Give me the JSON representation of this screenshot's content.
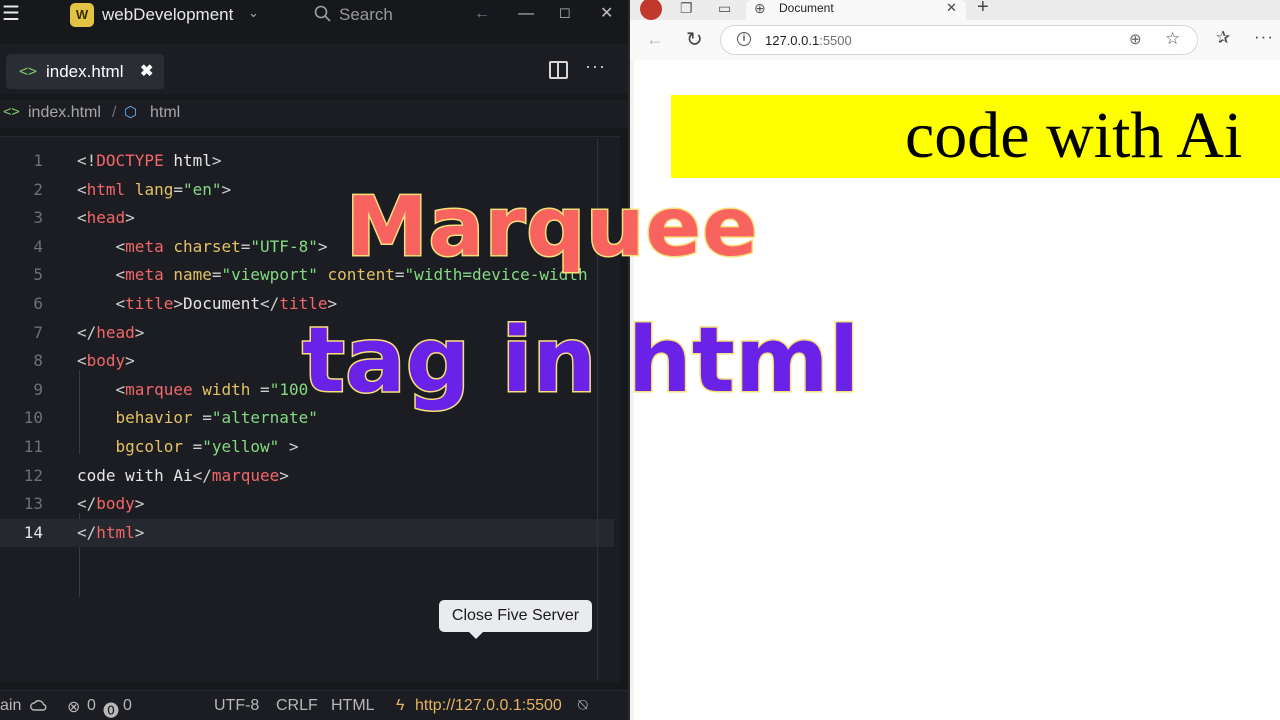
{
  "editor": {
    "workspace_badge": "W",
    "workspace_name": "webDevelopment",
    "search_placeholder": "Search",
    "tab": {
      "label": "index.html",
      "close": "✖"
    },
    "breadcrumb": {
      "file": "index.html",
      "separator": "/",
      "node": "html"
    },
    "code_lines": [
      {
        "n": "1",
        "tokens": [
          [
            "punc",
            "<!"
          ],
          [
            "tag",
            "DOCTYPE"
          ],
          [
            "text",
            " html"
          ],
          [
            "punc",
            ">"
          ]
        ]
      },
      {
        "n": "2",
        "tokens": [
          [
            "punc",
            "<"
          ],
          [
            "tag",
            "html"
          ],
          [
            "attr",
            " lang"
          ],
          [
            "punc",
            "="
          ],
          [
            "str",
            "\"en\""
          ],
          [
            "punc",
            ">"
          ]
        ]
      },
      {
        "n": "3",
        "tokens": [
          [
            "punc",
            "<"
          ],
          [
            "tag",
            "head"
          ],
          [
            "punc",
            ">"
          ]
        ]
      },
      {
        "n": "4",
        "tokens": [
          [
            "text",
            "    "
          ],
          [
            "punc",
            "<"
          ],
          [
            "tag",
            "meta"
          ],
          [
            "attr",
            " charset"
          ],
          [
            "punc",
            "="
          ],
          [
            "str",
            "\"UTF-8\""
          ],
          [
            "punc",
            ">"
          ]
        ]
      },
      {
        "n": "5",
        "tokens": [
          [
            "text",
            "    "
          ],
          [
            "punc",
            "<"
          ],
          [
            "tag",
            "meta"
          ],
          [
            "attr",
            " name"
          ],
          [
            "punc",
            "="
          ],
          [
            "str",
            "\"viewport\""
          ],
          [
            "attr",
            " content"
          ],
          [
            "punc",
            "="
          ],
          [
            "str",
            "\"width=device-width"
          ]
        ]
      },
      {
        "n": "6",
        "tokens": [
          [
            "text",
            "    "
          ],
          [
            "punc",
            "<"
          ],
          [
            "tag",
            "title"
          ],
          [
            "punc",
            ">"
          ],
          [
            "text",
            "Document"
          ],
          [
            "punc",
            "</"
          ],
          [
            "tag",
            "title"
          ],
          [
            "punc",
            ">"
          ]
        ]
      },
      {
        "n": "7",
        "tokens": [
          [
            "punc",
            "</"
          ],
          [
            "tag",
            "head"
          ],
          [
            "punc",
            ">"
          ]
        ]
      },
      {
        "n": "8",
        "tokens": [
          [
            "punc",
            "<"
          ],
          [
            "tag",
            "body"
          ],
          [
            "punc",
            ">"
          ]
        ]
      },
      {
        "n": "9",
        "tokens": [
          [
            "text",
            "    "
          ],
          [
            "punc",
            "<"
          ],
          [
            "tag",
            "marquee"
          ],
          [
            "attr",
            " width "
          ],
          [
            "punc",
            "="
          ],
          [
            "str",
            "\"100"
          ]
        ]
      },
      {
        "n": "10",
        "tokens": [
          [
            "text",
            "    "
          ],
          [
            "attr",
            "behavior "
          ],
          [
            "punc",
            "="
          ],
          [
            "str",
            "\"alternate\""
          ]
        ]
      },
      {
        "n": "11",
        "tokens": [
          [
            "text",
            "    "
          ],
          [
            "attr",
            "bgcolor "
          ],
          [
            "punc",
            "="
          ],
          [
            "str",
            "\"yellow\""
          ],
          [
            "punc",
            " >"
          ]
        ]
      },
      {
        "n": "12",
        "tokens": [
          [
            "text",
            "code with Ai"
          ],
          [
            "punc",
            "</"
          ],
          [
            "tag",
            "marquee"
          ],
          [
            "punc",
            ">"
          ]
        ]
      },
      {
        "n": "13",
        "tokens": [
          [
            "punc",
            "</"
          ],
          [
            "tag",
            "body"
          ],
          [
            "punc",
            ">"
          ]
        ]
      },
      {
        "n": "14",
        "tokens": [
          [
            "punc",
            "</"
          ],
          [
            "tag",
            "html"
          ],
          [
            "punc",
            ">"
          ]
        ]
      }
    ],
    "active_line": "14",
    "tooltip": "Close Five Server",
    "status": {
      "branch": "ain",
      "errors": "0",
      "warnings": "0",
      "encoding": "UTF-8",
      "eol": "CRLF",
      "language": "HTML",
      "live_server": "http://127.0.0.1:5500"
    }
  },
  "browser": {
    "tab_title": "Document",
    "tab_close": "✕",
    "address": "127.0.0.1",
    "address_port": ":5500",
    "marquee_text": "code with Ai",
    "marquee_bg": "#ffff00"
  },
  "overlay": {
    "line1": "Marquee",
    "line2": "tag in html",
    "line1_color": "#f86360",
    "line2_color": "#6a21e8"
  },
  "icons": [
    "menu-icon",
    "chevron-down-icon",
    "search-icon",
    "back-arrow-icon",
    "minimize-icon",
    "maximize-icon",
    "close-icon",
    "code-file-icon",
    "split-editor-icon",
    "more-icon",
    "cube-icon",
    "cloud-icon",
    "error-icon",
    "warning-icon",
    "bolt-icon",
    "bell-off-icon",
    "globe-icon",
    "reload-icon",
    "info-icon",
    "zoom-icon",
    "star-icon",
    "favorites-icon"
  ]
}
